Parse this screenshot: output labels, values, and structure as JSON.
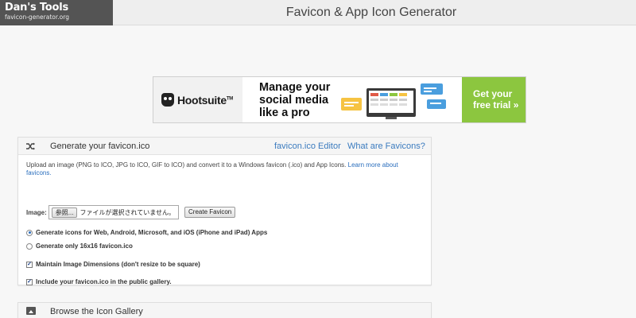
{
  "header": {
    "logo_title": "Dan's Tools",
    "logo_subtitle": "favicon-generator.org",
    "site_title": "Favicon & App Icon Generator"
  },
  "ad": {
    "brand": "Hootsuite",
    "headline": "Manage your social media like a pro",
    "cta": "Get your free trial »",
    "cta_color": "#8cc63f"
  },
  "generator": {
    "icon": "shuffle-icon",
    "title": "Generate your favicon.ico",
    "links": [
      "favicon.ico Editor",
      "What are Favicons?"
    ],
    "description": "Upload an image (PNG to ICO, JPG to ICO, GIF to ICO) and convert it to a Windows favicon (.ico) and App Icons.",
    "learn_more": "Learn more about favicons.",
    "image_label": "Image:",
    "browse_label": "参照...",
    "no_file_text": "ファイルが選択されていません。",
    "create_button": "Create Favicon",
    "options": [
      {
        "label": "Generate icons for Web, Android, Microsoft, and iOS (iPhone and iPad) Apps",
        "type": "radio",
        "checked": true
      },
      {
        "label": "Generate only 16x16 favicon.ico",
        "type": "radio",
        "checked": false
      },
      {
        "label": "Maintain Image Dimensions (don't resize to be square)",
        "type": "checkbox",
        "checked": true
      },
      {
        "label": "Include your favicon.ico in the public gallery.",
        "type": "checkbox",
        "checked": true
      }
    ]
  },
  "gallery": {
    "icon": "image-icon",
    "title": "Browse the Icon Gallery"
  },
  "colors": {
    "link": "#3b7bbf",
    "logo_bg": "#545454"
  }
}
